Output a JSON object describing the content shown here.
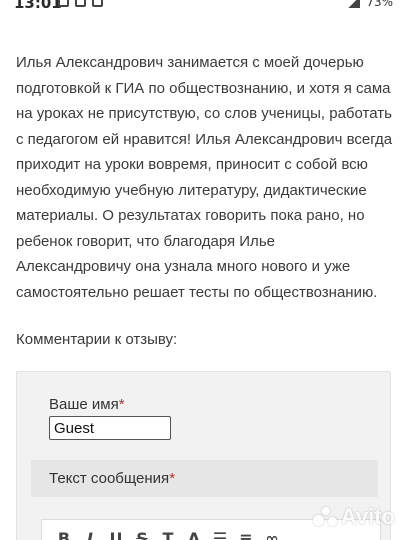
{
  "status_bar": {
    "time": "13:01",
    "battery": "73%"
  },
  "review": {
    "text": "Илья Александрович занимается с моей дочерью подготовкой к ГИА по обществознанию, и хотя я сама на уроках не присутствую, со слов ученицы, работать с педагогом ей нравится! Илья Александрович всегда приходит на уроки вовремя, приносит с собой всю необходимую учебную литературу, дидактические материалы. О результатах говорить пока рано, но ребенок говорит, что благодаря Илье Александровичу она узнала много нового и уже самостоятельно решает тесты по обществознанию.",
    "comments_label": "Комментарии к отзыву:"
  },
  "comment_form": {
    "name_label": "Ваше имя",
    "required_mark": "*",
    "name_value": "Guest",
    "message_label": "Текст сообщения",
    "toolbar": [
      "B",
      "I",
      "U",
      "S",
      "T",
      "A",
      "list-icon",
      "numbered-list-icon",
      "link-icon"
    ]
  },
  "watermark": "Avito",
  "colors": {
    "required": "#d62020",
    "panel_bg": "#f2f2f2",
    "header_bg": "#e6e6e6"
  }
}
